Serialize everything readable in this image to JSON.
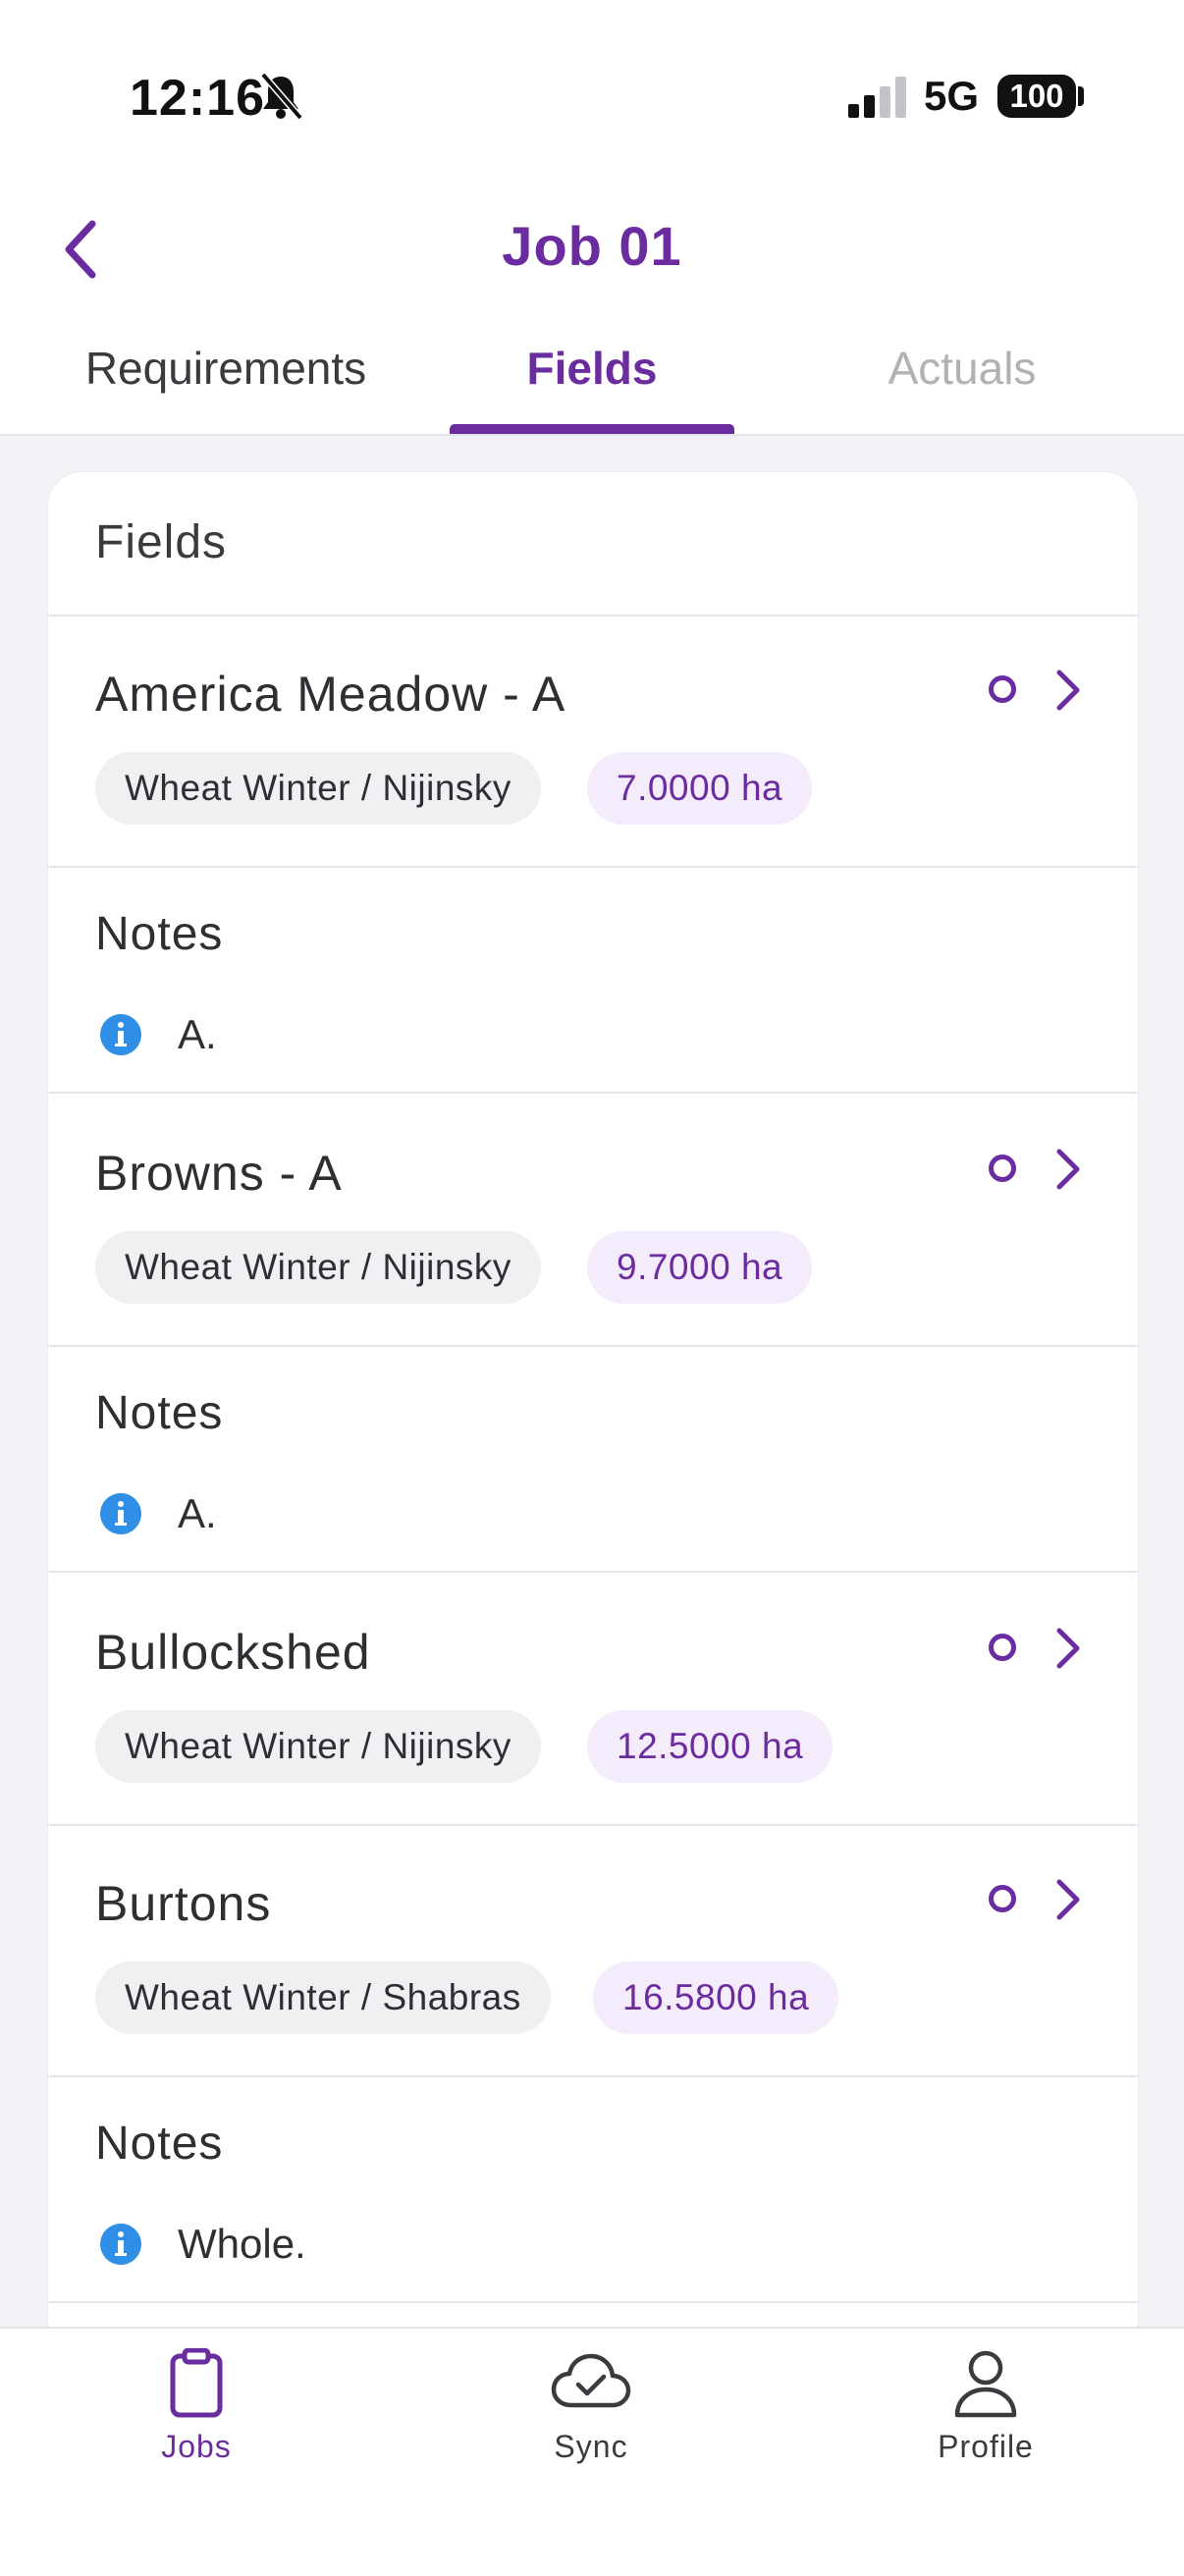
{
  "status_bar": {
    "time": "12:16",
    "network": "5G",
    "battery": "100"
  },
  "header": {
    "title": "Job 01",
    "back_icon": "chevron-left-icon"
  },
  "tabs": [
    {
      "label": "Requirements"
    },
    {
      "label": "Fields",
      "active": true
    },
    {
      "label": "Actuals"
    }
  ],
  "card": {
    "title": "Fields",
    "fields": [
      {
        "name": "America Meadow - A",
        "crop": "Wheat Winter / Nijinsky",
        "area": "7.0000 ha"
      },
      {
        "name": "Browns - A",
        "crop": "Wheat Winter / Nijinsky",
        "area": "9.7000 ha"
      },
      {
        "name": "Bullockshed",
        "crop": "Wheat Winter / Nijinsky",
        "area": "12.5000 ha"
      },
      {
        "name": "Burtons",
        "crop": "Wheat Winter / Shabras",
        "area": "16.5800 ha"
      }
    ],
    "notes": [
      {
        "title": "Notes",
        "text": "A."
      },
      {
        "title": "Notes",
        "text": "A."
      },
      {
        "title": "Notes",
        "text": "Whole."
      }
    ]
  },
  "bottom_nav": [
    {
      "label": "Jobs",
      "icon": "clipboard-icon",
      "active": true
    },
    {
      "label": "Sync",
      "icon": "cloud-check-icon"
    },
    {
      "label": "Profile",
      "icon": "person-icon"
    }
  ],
  "colors": {
    "accent": "#6a2c9e",
    "info": "#2f8fe6",
    "background": "#f2f1f6"
  }
}
